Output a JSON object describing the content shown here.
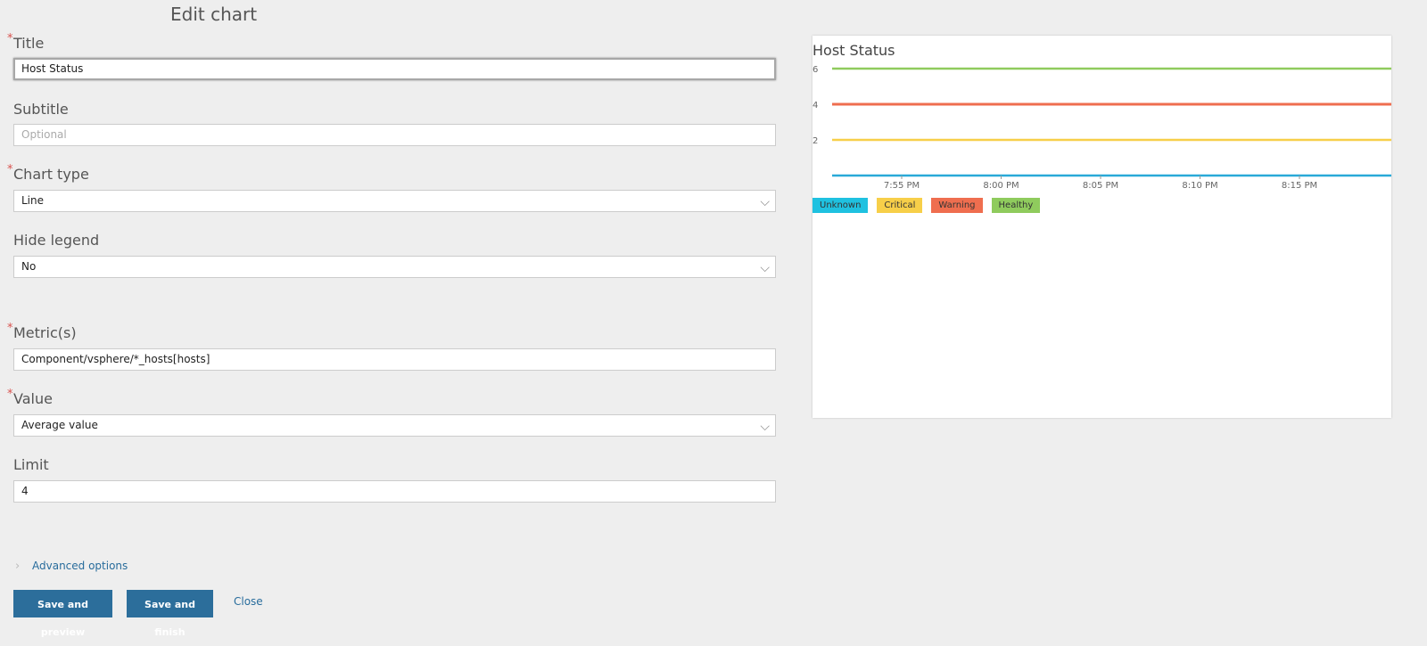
{
  "page_title": "Edit chart",
  "form": {
    "title": {
      "label": "Title",
      "required_mark": "*",
      "value": "Host Status"
    },
    "subtitle": {
      "label": "Subtitle",
      "placeholder": "Optional"
    },
    "chart_type": {
      "label": "Chart type",
      "required_mark": "*",
      "value": "Line"
    },
    "hide_legend": {
      "label": "Hide legend",
      "value": "No"
    },
    "metrics": {
      "label": "Metric(s)",
      "required_mark": "*",
      "value": "Component/vsphere/*_hosts[hosts]"
    },
    "value": {
      "label": "Value",
      "required_mark": "*",
      "value": "Average value"
    },
    "limit": {
      "label": "Limit",
      "value": "4"
    },
    "chevron": "⌵"
  },
  "advanced": {
    "arrow": "›",
    "label": "Advanced options"
  },
  "buttons": {
    "save_preview": "Save and preview",
    "save_finish": "Save and finish",
    "close": "Close"
  },
  "chart_data": {
    "type": "line",
    "title": "Host Status",
    "x_ticks": [
      "7:55 PM",
      "8:00 PM",
      "8:05 PM",
      "8:10 PM",
      "8:15 PM"
    ],
    "y_ticks": [
      2,
      4,
      6
    ],
    "ylim": [
      0,
      6
    ],
    "grid": false,
    "legend_position": "bottom-left",
    "series": [
      {
        "name": "Unknown",
        "color": "#29a9d8",
        "value": 0
      },
      {
        "name": "Critical",
        "color": "#f7cf49",
        "value": 2
      },
      {
        "name": "Warning",
        "color": "#ef6e4f",
        "value": 4
      },
      {
        "name": "Healthy",
        "color": "#8fcb5d",
        "value": 6
      }
    ],
    "legend_colors": [
      "#1fc1e0",
      "#f7cf49",
      "#ef6e4f",
      "#8fcb5d"
    ]
  }
}
